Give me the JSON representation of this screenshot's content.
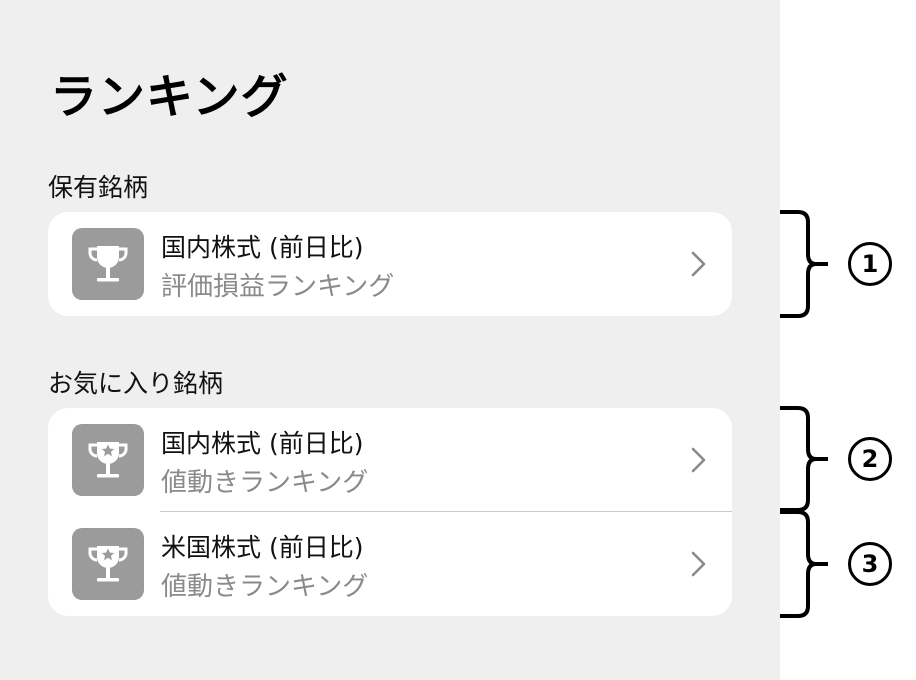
{
  "page": {
    "title": "ランキング"
  },
  "sections": [
    {
      "header": "保有銘柄",
      "rows": [
        {
          "title": "国内株式 (前日比)",
          "subtitle": "評価損益ランキング",
          "icon": "trophy-icon"
        }
      ]
    },
    {
      "header": "お気に入り銘柄",
      "rows": [
        {
          "title": "国内株式 (前日比)",
          "subtitle": "値動きランキング",
          "icon": "trophy-star-icon"
        },
        {
          "title": "米国株式 (前日比)",
          "subtitle": "値動きランキング",
          "icon": "trophy-star-icon"
        }
      ]
    }
  ],
  "annotations": [
    "1",
    "2",
    "3"
  ],
  "colors": {
    "background": "#efefef",
    "card": "#ffffff",
    "icon_bg": "#9b9b9b",
    "subtitle": "#8a8a8a"
  }
}
